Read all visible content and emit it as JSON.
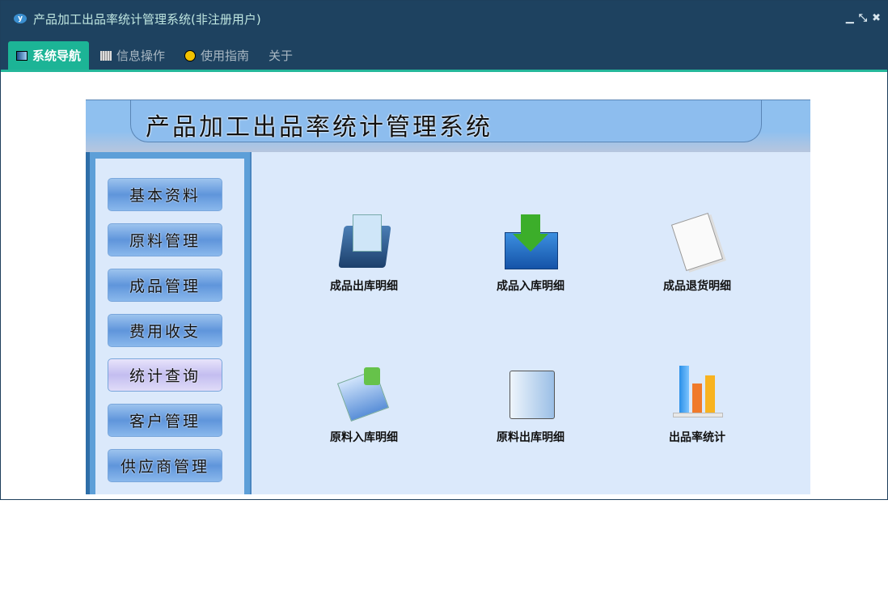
{
  "window": {
    "title": "产品加工出品率统计管理系统(非注册用户)",
    "logo": "y",
    "controls": [
      "minimize",
      "restore",
      "close"
    ]
  },
  "tabs": [
    {
      "label": "系统导航",
      "icon": "monitor-icon"
    },
    {
      "label": "信息操作",
      "icon": "grid-icon"
    },
    {
      "label": "使用指南",
      "icon": "help-icon"
    },
    {
      "label": "关于"
    }
  ],
  "app": {
    "title": "产品加工出品率统计管理系统",
    "sidebar": [
      "基本资料",
      "原料管理",
      "成品管理",
      "费用收支",
      "统计查询",
      "客户管理",
      "供应商管理"
    ],
    "selected": "统计查询",
    "items": [
      {
        "label": "成品出库明细",
        "icon": "folder-doc-icon"
      },
      {
        "label": "成品入库明细",
        "icon": "download-tray-icon"
      },
      {
        "label": "成品退货明细",
        "icon": "notepad-icon"
      },
      {
        "label": "原料入库明细",
        "icon": "doc-download-icon"
      },
      {
        "label": "原料出库明细",
        "icon": "folder-icon"
      },
      {
        "label": "出品率统计",
        "icon": "bar-chart-icon"
      }
    ]
  }
}
